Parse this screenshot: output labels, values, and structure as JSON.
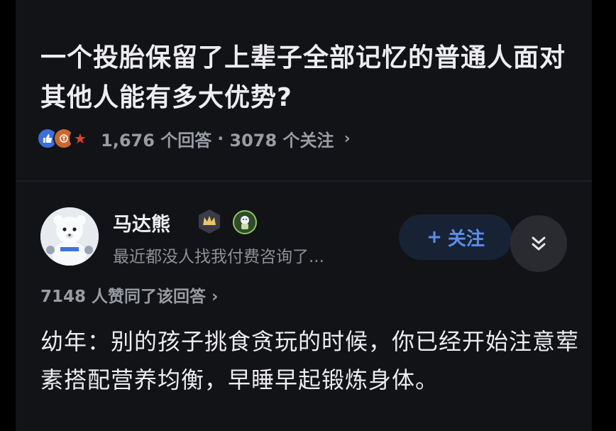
{
  "question": {
    "title": "一个投胎保留了上辈子全部记忆的普通人面对其他人能有多大优势?",
    "answers_count": "1,676 个回答",
    "separator": "·",
    "followers": "3078 个关注",
    "chevron": "›"
  },
  "author": {
    "name": "马达熊",
    "bio": "最近都没人找我付费咨询了..."
  },
  "actions": {
    "follow_plus": "+",
    "follow_label": "关注"
  },
  "answer": {
    "upvotes_text": "7148 人赞同了该回答",
    "chevron": "›",
    "text": "幼年：别的孩子挑食贪玩的时候，你已经开始注意荤素搭配营养均衡，早睡早起锻炼身体。"
  },
  "colors": {
    "background": "#121317",
    "accent": "#5c8ee8",
    "follow_bg": "#182235"
  }
}
